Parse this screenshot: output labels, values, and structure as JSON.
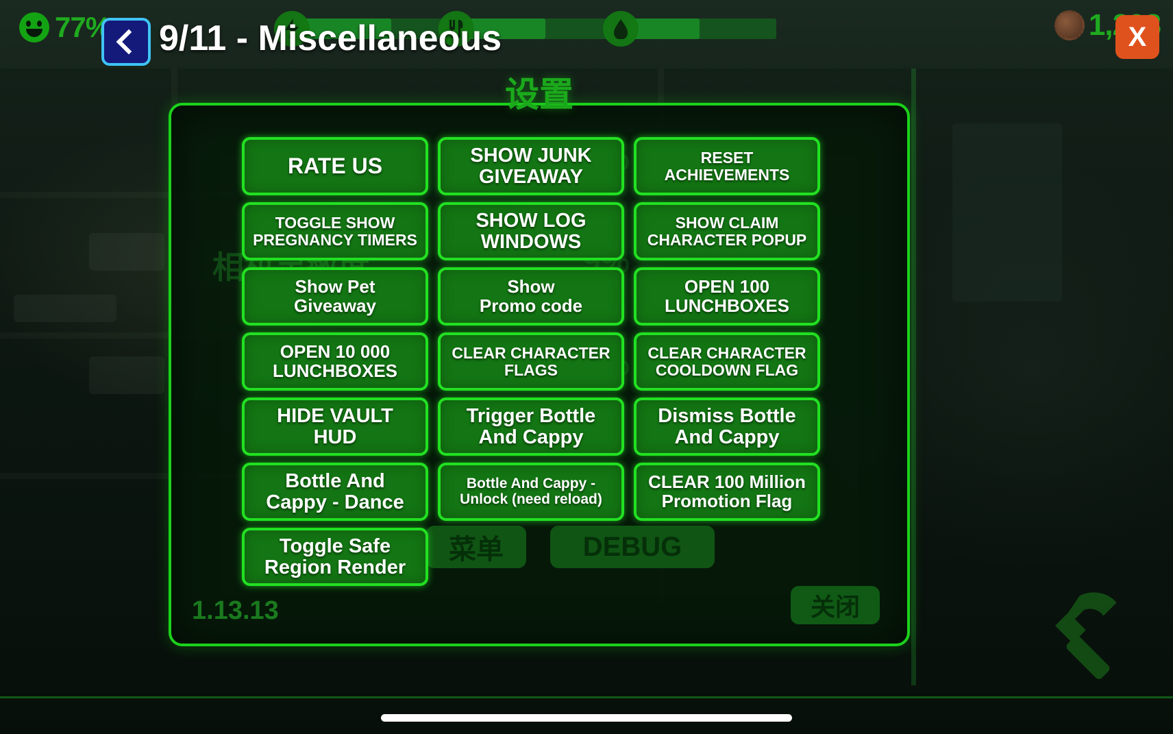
{
  "header": {
    "back_label": "<",
    "back_icon": "chevron-left-icon",
    "title": "9/11 - Miscellaneous",
    "close_label": "X",
    "close_icon": "close-icon"
  },
  "hud": {
    "happiness_icon": "smiley-icon",
    "happiness_value": "77%",
    "caps_icon": "bottlecap-icon",
    "caps_value": "1,298",
    "resources": [
      {
        "icon": "power-icon",
        "glyph": "⚡",
        "fill_pct": 62
      },
      {
        "icon": "food-icon",
        "glyph": "🍴",
        "fill_pct": 55
      },
      {
        "icon": "water-icon",
        "glyph": "💧",
        "fill_pct": 48
      }
    ]
  },
  "background_dialog": {
    "title": "设置",
    "version": "1.13.13",
    "ghost_label": "相机灵敏度",
    "ghost_pct_1": "9%",
    "ghost_pct_2": "9%",
    "ghost_pct_3": "9%",
    "menu_button": "菜单",
    "debug_button": "DEBUG",
    "close_button": "关闭"
  },
  "debug_panel": {
    "buttons": [
      {
        "label": "RATE US",
        "size": "s-xl"
      },
      {
        "label": "SHOW JUNK\nGIVEAWAY",
        "size": "s-lg"
      },
      {
        "label": "RESET ACHIEVEMENTS",
        "size": "s-sm"
      },
      {
        "label": "TOGGLE SHOW\nPREGNANCY TIMERS",
        "size": "s-sm"
      },
      {
        "label": "SHOW LOG\nWINDOWS",
        "size": "s-lg"
      },
      {
        "label": "SHOW CLAIM\nCHARACTER POPUP",
        "size": "s-sm"
      },
      {
        "label": "Show Pet\nGiveaway",
        "size": "s-md"
      },
      {
        "label": "Show\nPromo code",
        "size": "s-md"
      },
      {
        "label": "OPEN 100\nLUNCHBOXES",
        "size": "s-md"
      },
      {
        "label": "OPEN 10 000\nLUNCHBOXES",
        "size": "s-md"
      },
      {
        "label": "CLEAR CHARACTER\nFLAGS",
        "size": "s-sm"
      },
      {
        "label": "CLEAR CHARACTER\nCOOLDOWN FLAG",
        "size": "s-sm"
      },
      {
        "label": "HIDE VAULT\nHUD",
        "size": "s-lg"
      },
      {
        "label": "Trigger Bottle\nAnd Cappy",
        "size": "s-lg"
      },
      {
        "label": "Dismiss Bottle\nAnd Cappy",
        "size": "s-lg"
      },
      {
        "label": "Bottle And\nCappy - Dance",
        "size": "s-lg"
      },
      {
        "label": "Bottle And Cappy -\nUnlock (need reload)",
        "size": "s-xs"
      },
      {
        "label": "CLEAR 100 Million\nPromotion Flag",
        "size": "s-md"
      },
      {
        "label": "Toggle Safe\nRegion Render",
        "size": "s-lg"
      },
      {
        "label": "",
        "size": "empty"
      },
      {
        "label": "",
        "size": "empty"
      }
    ]
  },
  "system": {
    "home_indicator": "home-indicator"
  },
  "colors": {
    "button_fill": "#137513",
    "button_border": "#22e022",
    "panel_border": "#1bd21b",
    "back_button_bg": "#141a7a",
    "back_button_border": "#3fc4f5",
    "close_button_bg": "#e0521d",
    "hud_green": "#1faa1f",
    "version_green": "#1a7a1e"
  }
}
